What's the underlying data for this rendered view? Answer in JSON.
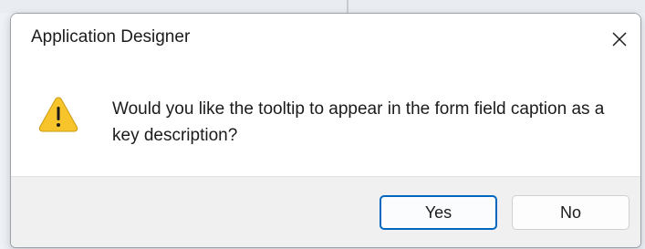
{
  "dialog": {
    "title": "Application Designer",
    "message": "Would you like the tooltip to appear in the form field caption as a key description?",
    "icon": "warning-icon",
    "buttons": {
      "yes_label": "Yes",
      "no_label": "No"
    }
  },
  "colors": {
    "accent": "#0067c0",
    "warning_fill": "#f7c52b",
    "warning_glyph": "#1b1b1b",
    "footer_bg": "#f0f0f0"
  }
}
